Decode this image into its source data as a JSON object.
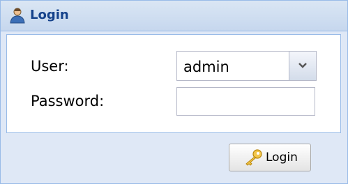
{
  "panel": {
    "title": "Login",
    "icon": "user-icon"
  },
  "form": {
    "user": {
      "label": "User:",
      "value": "admin",
      "trigger_icon": "chevron-down-icon"
    },
    "password": {
      "label": "Password:",
      "value": ""
    }
  },
  "actions": {
    "login_label": "Login",
    "login_icon": "key-icon"
  },
  "colors": {
    "header_bg": "#c6d7ee",
    "title_text": "#15428b",
    "panel_border": "#99bbe8",
    "panel_bg": "#dfe8f6"
  }
}
